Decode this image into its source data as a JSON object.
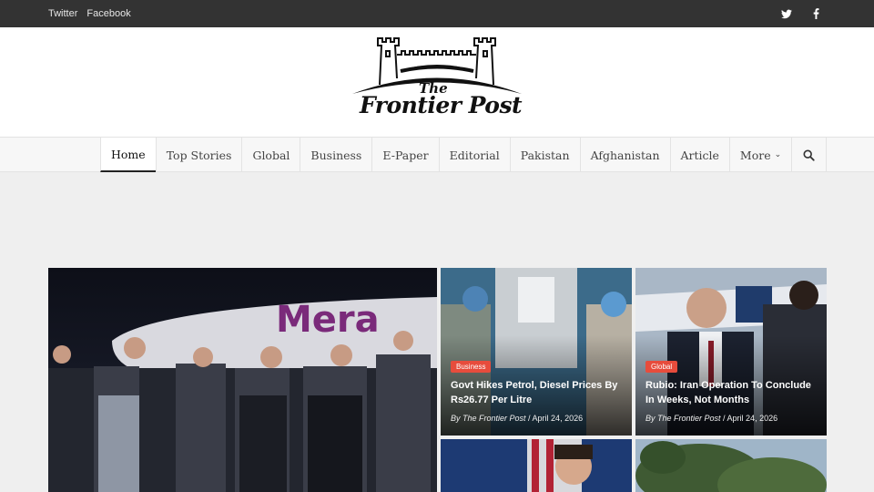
{
  "topbar": {
    "links": [
      "Twitter",
      "Facebook"
    ],
    "social_icons": [
      "twitter-icon",
      "facebook-icon"
    ]
  },
  "logo": {
    "the": "The",
    "name": "Frontier Post"
  },
  "nav": {
    "items": [
      "Home",
      "Top Stories",
      "Global",
      "Business",
      "E-Paper",
      "Editorial",
      "Pakistan",
      "Afghanistan",
      "Article",
      "More"
    ],
    "active": "Home",
    "search_icon": "search-icon"
  },
  "posts": [
    {
      "category": "Business",
      "title": "Govt Hikes Petrol, Diesel Prices By Rs26.77 Per Litre",
      "author": "By The Frontier Post",
      "date": "April 24, 2026"
    },
    {
      "category": "Global",
      "title": "Rubio: Iran Operation To Conclude In Weeks, Not Months",
      "author": "By The Frontier Post",
      "date": "April 24, 2026"
    }
  ],
  "colors": {
    "topbar": "#333333",
    "badge": "#e74c3c",
    "page_bg": "#efefef"
  }
}
